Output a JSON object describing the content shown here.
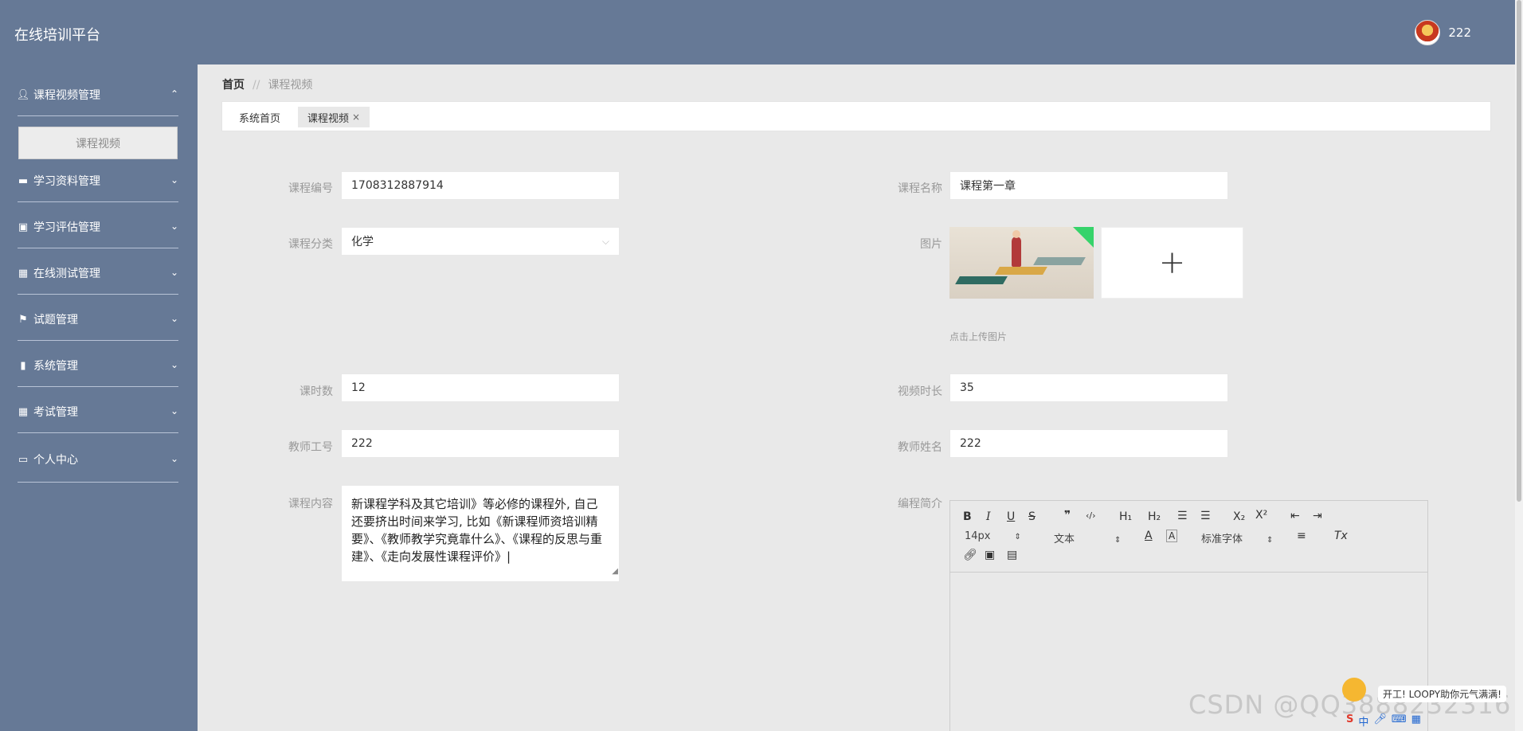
{
  "header": {
    "title": "在线培训平台",
    "user_name": "222"
  },
  "sidebar": {
    "items": [
      {
        "label": "课程视频管理",
        "icon": "user-icon",
        "chevron": "⌃"
      },
      {
        "label": "学习资料管理",
        "icon": "ticket-icon",
        "chevron": "⌄"
      },
      {
        "label": "学习评估管理",
        "icon": "clipboard-icon",
        "chevron": "⌄"
      },
      {
        "label": "在线测试管理",
        "icon": "grid-icon",
        "chevron": "⌄"
      },
      {
        "label": "试题管理",
        "icon": "flag-icon",
        "chevron": "⌄"
      },
      {
        "label": "系统管理",
        "icon": "bar-chart-icon",
        "chevron": "⌄"
      },
      {
        "label": "考试管理",
        "icon": "grid-icon",
        "chevron": "⌄"
      },
      {
        "label": "个人中心",
        "icon": "card-icon",
        "chevron": "⌄"
      }
    ],
    "sub_item": "课程视频"
  },
  "breadcrumb": {
    "home": "首页",
    "sep": "//",
    "current": "课程视频"
  },
  "tabs": [
    {
      "label": "系统首页"
    },
    {
      "label": "课程视频",
      "close": "×"
    }
  ],
  "form": {
    "course_no": {
      "label": "课程编号",
      "value": "1708312887914"
    },
    "course_name": {
      "label": "课程名称",
      "value": "课程第一章"
    },
    "category": {
      "label": "课程分类",
      "value": "化学"
    },
    "image": {
      "label": "图片",
      "upload_hint": "点击上传图片",
      "plus": "+"
    },
    "hours": {
      "label": "课时数",
      "value": "12"
    },
    "duration": {
      "label": "视频时长",
      "value": "35"
    },
    "teacher_no": {
      "label": "教师工号",
      "value": "222"
    },
    "teacher_name": {
      "label": "教师姓名",
      "value": "222"
    },
    "content": {
      "label": "课程内容",
      "value": "新课程学科及其它培训》等必修的课程外, 自己还要挤出时间来学习, 比如《新课程师资培训精要》、《教师教学究竟靠什么》、《课程的反思与重建》、《走向发展性课程评价》|"
    },
    "intro": {
      "label": "编程简介"
    }
  },
  "editor": {
    "font_size": "14px",
    "text_type": "文本",
    "font_family": "标准字体"
  },
  "overlay": {
    "watermark": "CSDN @QQ3888232316",
    "loopy": "开工! LOOPY助你元气满满!",
    "ime": "中"
  }
}
